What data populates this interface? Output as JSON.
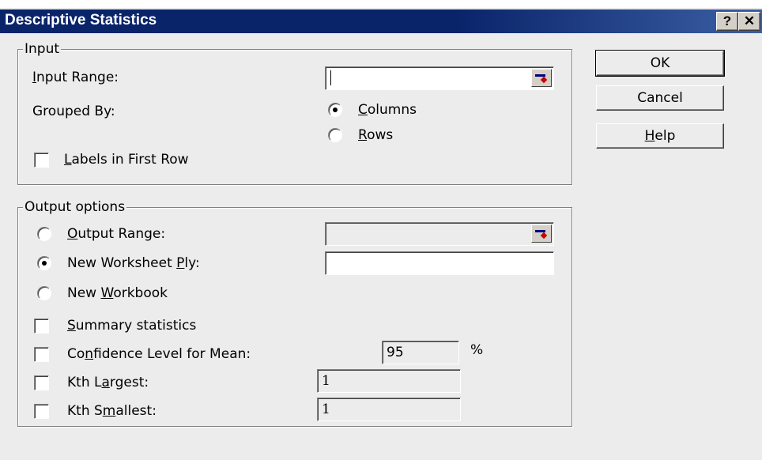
{
  "window": {
    "title": "Descriptive Statistics",
    "help_glyph": "?",
    "close_glyph": "✕"
  },
  "input_group": {
    "legend": "Input",
    "input_range_label_mn": "I",
    "input_range_label_rest": "nput Range:",
    "input_range_value": "",
    "grouped_by_label": "Grouped By:",
    "columns_mn": "C",
    "columns_rest": "olumns",
    "columns_selected": true,
    "rows_mn": "R",
    "rows_rest": "ows",
    "labels_mn": "L",
    "labels_rest": "abels in First Row"
  },
  "output_group": {
    "legend": "Output options",
    "output_range_mn": "O",
    "output_range_rest": "utput Range:",
    "output_range_value": "",
    "new_sheet_pre": "New Worksheet ",
    "new_sheet_mn": "P",
    "new_sheet_post": "ly:",
    "new_sheet_value": "",
    "new_sheet_selected": true,
    "new_wb_pre": "New ",
    "new_wb_mn": "W",
    "new_wb_post": "orkbook",
    "summary_mn": "S",
    "summary_rest": "ummary statistics",
    "conf_pre": "Co",
    "conf_mn": "n",
    "conf_post": "fidence Level for Mean:",
    "conf_value": "95",
    "conf_unit": "%",
    "kth_largest_pre": "Kth L",
    "kth_largest_mn": "a",
    "kth_largest_post": "rgest:",
    "kth_largest_value": "1",
    "kth_smallest_pre": "Kth S",
    "kth_smallest_mn": "m",
    "kth_smallest_post": "allest:",
    "kth_smallest_value": "1"
  },
  "buttons": {
    "ok": "OK",
    "cancel": "Cancel",
    "help_mn": "H",
    "help_rest": "elp"
  },
  "icons": {
    "range_ref": "collapse-dialog-icon",
    "help": "help-icon",
    "close": "close-icon"
  }
}
